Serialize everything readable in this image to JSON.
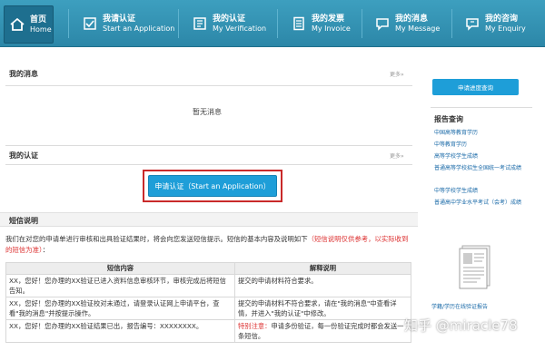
{
  "nav": {
    "items": [
      {
        "zh": "首页",
        "en": "Home",
        "icon": "home-icon"
      },
      {
        "zh": "我请认证",
        "en": "Start an Application",
        "icon": "apply-icon"
      },
      {
        "zh": "我的认证",
        "en": "My Verification",
        "icon": "verification-icon"
      },
      {
        "zh": "我的发票",
        "en": "My Invoice",
        "icon": "invoice-icon"
      },
      {
        "zh": "我的消息",
        "en": "My Message",
        "icon": "message-icon"
      },
      {
        "zh": "我的咨询",
        "en": "My Enquiry",
        "icon": "enquiry-icon"
      }
    ]
  },
  "messages": {
    "title": "我的消息",
    "more": "更多»",
    "empty": "暂无消息"
  },
  "verification": {
    "title": "我的认证",
    "more": "更多»",
    "apply_button": "申请认证（Start an Application）"
  },
  "sms": {
    "title": "短信说明",
    "desc_normal": "我们在对您的申请单进行审核和出具验证结果时，将会向您发送短信提示。短信的基本内容及说明如下",
    "desc_red": "（短信说明仅供参考，以实际收到的短信为准）",
    "desc_tail": "：",
    "col_content": "短信内容",
    "col_explain": "解释说明",
    "rows": [
      {
        "content": "XX，您好！您办理的XX验证已进入资料信息审核环节，审核完成后将短信告知。",
        "explain": "提交的申请材料符合要求。",
        "explain_red": ""
      },
      {
        "content": "XX，您好！您办理的XX验证校对未通过，请登录认证网上申请平台，查看\"我的消息\"并按提示操作。",
        "explain": "提交的申请材料不符合要求，请在\"我的消息\"中查看详情，并进入\"我的认证\"中修改。",
        "explain_red": ""
      },
      {
        "content": "XX，您好！您办理的XX验证结果已出，报告编号：XXXXXXXX。",
        "explain": "申请多份验证，每一份验证完成时都会发送一条短信。",
        "explain_red": "特别注意："
      }
    ]
  },
  "right": {
    "progress_button": "申请进度查询",
    "report_title": "报告查询",
    "links": [
      "中国高等教育学历",
      "中等教育学历",
      "高等学校学生成绩",
      "普通高等学校招生全国统一考试成绩",
      "中等学校学生成绩",
      "普通高中学业水平考试（会考）成绩"
    ],
    "bottom_link": "学籍/学历在线验证报告"
  },
  "watermark": "知乎 @miracle78"
}
